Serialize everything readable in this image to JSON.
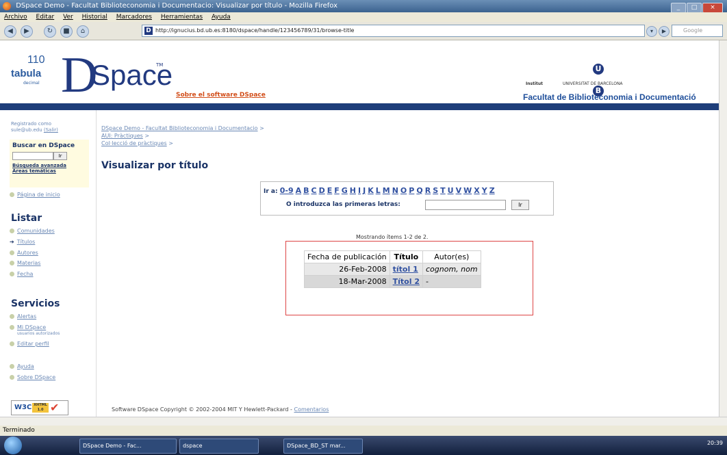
{
  "window": {
    "title": "DSpace Demo - Facultat Biblioteconomia i Documentacio: Visualizar por título - Mozilla Firefox"
  },
  "menu": [
    "Archivo",
    "Editar",
    "Ver",
    "Historial",
    "Marcadores",
    "Herramientas",
    "Ayuda"
  ],
  "browser": {
    "url": "http://ignucius.bd.ub.es:8180/dspace/handle/123456789/31/browse-title",
    "search_placeholder": "Google"
  },
  "header": {
    "tabula_top": "110",
    "tabula": "tabula",
    "tabula_sub": "decimal",
    "logo_D": "D",
    "logo_space": "Space",
    "logo_tm": "TM",
    "about_link": "Sobre el software DSpace",
    "ub_small": "UNIVERSITAT DE BARCELONA",
    "ub_small2": "Institut",
    "ub_letter1": "U",
    "ub_letter2": "B",
    "facultat": "Facultat de Biblioteconomia i Documentació"
  },
  "sidebar": {
    "registered_line1": "Registrado como",
    "registered_email": "sule@ub.edu",
    "registered_exit": "(Salir)",
    "search_title": "Buscar en DSpace",
    "search_go": "Ir",
    "advanced_search": "Búsqueda avanzada",
    "areas": "Áreas temáticas",
    "home": "Página de inicio",
    "listar_heading": "Listar",
    "listar_items": [
      "Comunidades",
      "Títulos",
      "Autores",
      "Materias",
      "Fecha"
    ],
    "servicios_heading": "Servicios",
    "alertas": "Alertas",
    "mi_dspace": "Mi DSpace",
    "mi_dspace_sub": "usuarios autorizados",
    "editar_perfil": "Editar perfil",
    "ayuda": "Ayuda",
    "sobre": "Sobre DSpace",
    "w3c": "W3C",
    "w3c_badge": "XHTML 1.0"
  },
  "breadcrumb": {
    "items": [
      "DSpace Demo - Facultat Biblioteconomia i Documentacio",
      "AUI: Pràctiques",
      "Col·lecció de pràctiques"
    ]
  },
  "page": {
    "title": "Visualizar por título",
    "ir_a": "Ir a:",
    "letters": [
      "0-9",
      "A",
      "B",
      "C",
      "D",
      "E",
      "F",
      "G",
      "H",
      "I",
      "J",
      "K",
      "L",
      "M",
      "N",
      "O",
      "P",
      "Q",
      "R",
      "S",
      "T",
      "U",
      "V",
      "W",
      "X",
      "Y",
      "Z"
    ],
    "introduzca": "O introduzca las primeras letras:",
    "go_button": "Ir",
    "mostrando": "Mostrando ítems 1-2 de 2."
  },
  "results": {
    "headers": [
      "Fecha de publicación",
      "Título",
      "Autor(es)"
    ],
    "rows": [
      {
        "date": "26-Feb-2008",
        "title": "títol 1",
        "author": "cognom, nom"
      },
      {
        "date": "18-Mar-2008",
        "title": "Títol 2",
        "author": "-"
      }
    ]
  },
  "footer": {
    "text": "Software DSpace  Copyright © 2002-2004  MIT  Y  Hewlett-Packard  -",
    "link": "Comentarios"
  },
  "status": "Terminado",
  "taskbar": {
    "tasks": [
      "DSpace Demo - Fac...",
      "dspace",
      "DSpace_BD_ST mar..."
    ],
    "clock": "20:39"
  }
}
